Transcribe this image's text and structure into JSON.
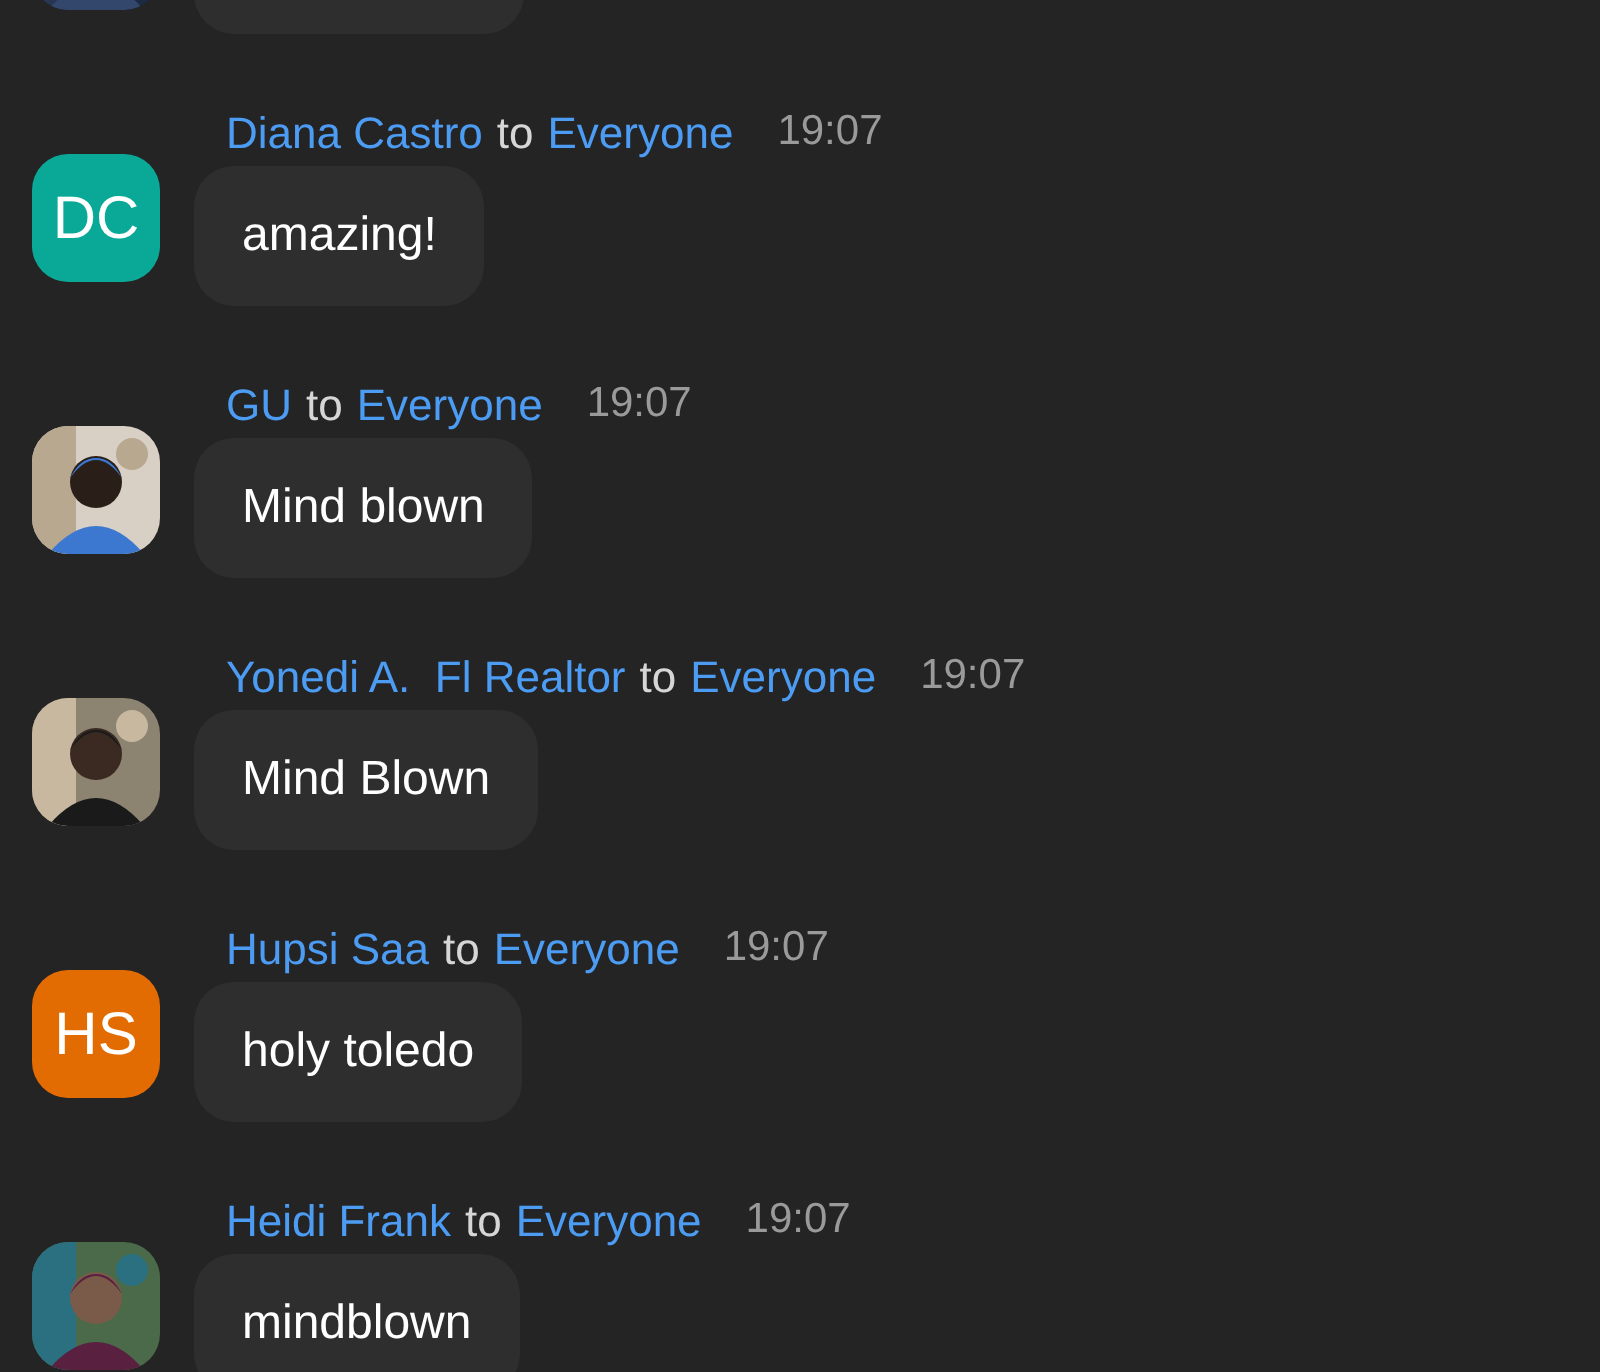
{
  "messages": [
    {
      "avatar": {
        "kind": "picture"
      }
    },
    {
      "sender": "Diana Castro",
      "to_word": "to",
      "recipient": "Everyone",
      "time": "19:07",
      "text": "amazing!",
      "avatar": {
        "kind": "initials",
        "initials": "DC",
        "color": "#0aa997"
      }
    },
    {
      "sender": "GU",
      "to_word": "to",
      "recipient": "Everyone",
      "time": "19:07",
      "text": "Mind blown",
      "avatar": {
        "kind": "picture"
      }
    },
    {
      "sender": "Yonedi A.  Fl Realtor",
      "to_word": "to",
      "recipient": "Everyone",
      "time": "19:07",
      "text": "Mind Blown",
      "avatar": {
        "kind": "picture"
      }
    },
    {
      "sender": "Hupsi Saa",
      "to_word": "to",
      "recipient": "Everyone",
      "time": "19:07",
      "text": "holy toledo",
      "avatar": {
        "kind": "initials",
        "initials": "HS",
        "color": "#e36c02"
      }
    },
    {
      "sender": "Heidi Frank",
      "to_word": "to",
      "recipient": "Everyone",
      "time": "19:07",
      "text": "mindblown",
      "avatar": {
        "kind": "picture"
      }
    }
  ]
}
